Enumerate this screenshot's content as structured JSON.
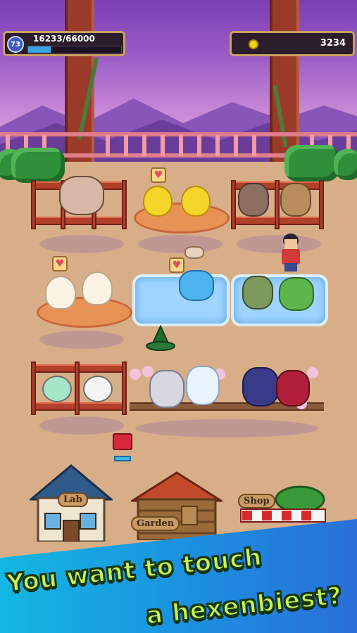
{
  "hud": {
    "level": "73",
    "xp_text": "16233/66000",
    "xp_progress": 0.246,
    "coins": "3234"
  },
  "buildings": {
    "lab_label": "Lab",
    "garden_label": "Garden",
    "shop_label": "Shop"
  },
  "banner": {
    "line1": "You want to touch",
    "line2": "a hexenbiest?"
  },
  "icons": {
    "level": "level-badge-icon",
    "coin": "coin-icon",
    "heart": "heart-icon",
    "chest": "treasure-chest-icon",
    "hat": "witch-hat-icon"
  },
  "colors": {
    "xp_fill": "#3aa2e6",
    "banner_text": "#c6f25a",
    "banner_bg": "#1c8fe0"
  }
}
